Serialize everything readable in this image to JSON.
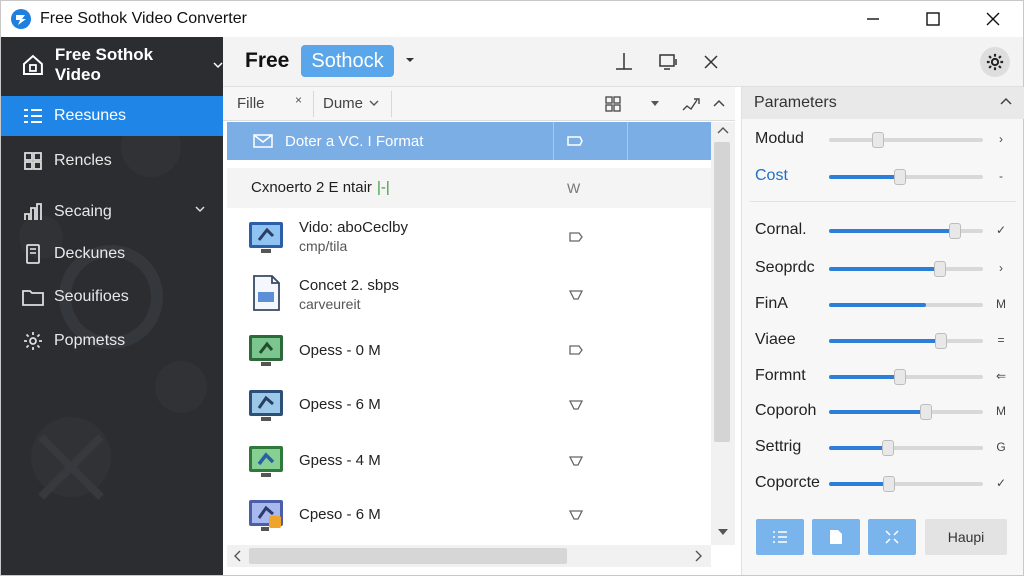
{
  "window": {
    "title": "Free Sothok Video Converter"
  },
  "sidebar": {
    "header": "Free Sothok Video",
    "items": [
      {
        "label": "Reesunes",
        "icon": "list-icon",
        "active": true
      },
      {
        "label": "Rencles",
        "icon": "grid-icon"
      },
      {
        "label": "Secaing",
        "icon": "chart-icon",
        "expandable": true
      },
      {
        "label": "Deckunes",
        "icon": "device-icon"
      },
      {
        "label": "Seouifioes",
        "icon": "folder-icon"
      },
      {
        "label": "Popmetss",
        "icon": "gear-icon"
      }
    ]
  },
  "header": {
    "brand_free": "Free",
    "brand_name": "Sothock"
  },
  "list_toolbar": {
    "file_label": "Fille",
    "file_close": "×",
    "name_label": "Dume"
  },
  "file_list": {
    "header_row": "Doter a VC.  I Format",
    "sub_row": "Cxnoerto 2 E ntair",
    "sub_mark": "|-|",
    "sub_action": "W",
    "rows": [
      {
        "line1": "Vido: aboCeclby",
        "line2": "cmp/tila",
        "thumb": "blue"
      },
      {
        "line1": "Concet  2. sbps",
        "line2": "carveureit",
        "thumb": "doc"
      },
      {
        "line1": "Opess - 0  M",
        "line2": "",
        "thumb": "green"
      },
      {
        "line1": "Opess - 6  M",
        "line2": "",
        "thumb": "blue"
      },
      {
        "line1": "Gpess - 4  M",
        "line2": "",
        "thumb": "green"
      },
      {
        "line1": "Cpeso - 6  M",
        "line2": "",
        "thumb": "orange"
      }
    ]
  },
  "parameters": {
    "title": "Parameters",
    "items": [
      {
        "label": "Modud",
        "value": 0.32,
        "end": "›",
        "filled": false
      },
      {
        "label": "Cost",
        "value": 0.46,
        "end": "-",
        "filled": true,
        "blue": true
      },
      {
        "label": "Cornal.",
        "value": 0.82,
        "end": "✓",
        "filled": true
      },
      {
        "label": "Seoprdc",
        "value": 0.72,
        "end": "›",
        "filled": true
      },
      {
        "label": "FinA",
        "value": 0.63,
        "end": "M",
        "filled": true,
        "noknob": true
      },
      {
        "label": "Viaee",
        "value": 0.73,
        "end": "=",
        "filled": true
      },
      {
        "label": "Formnt",
        "value": 0.46,
        "end": "⇐",
        "filled": true
      },
      {
        "label": "Coporoh",
        "value": 0.63,
        "end": "M",
        "filled": true
      },
      {
        "label": "Settrig",
        "value": 0.38,
        "end": "G",
        "filled": true
      },
      {
        "label": "Coporcte",
        "value": 0.39,
        "end": "✓",
        "filled": true
      }
    ],
    "footer_button": "Haupi"
  },
  "colors": {
    "accent": "#1f86e8",
    "sidebar_bg": "#2b2d30",
    "selected_row": "#7aaee5"
  }
}
